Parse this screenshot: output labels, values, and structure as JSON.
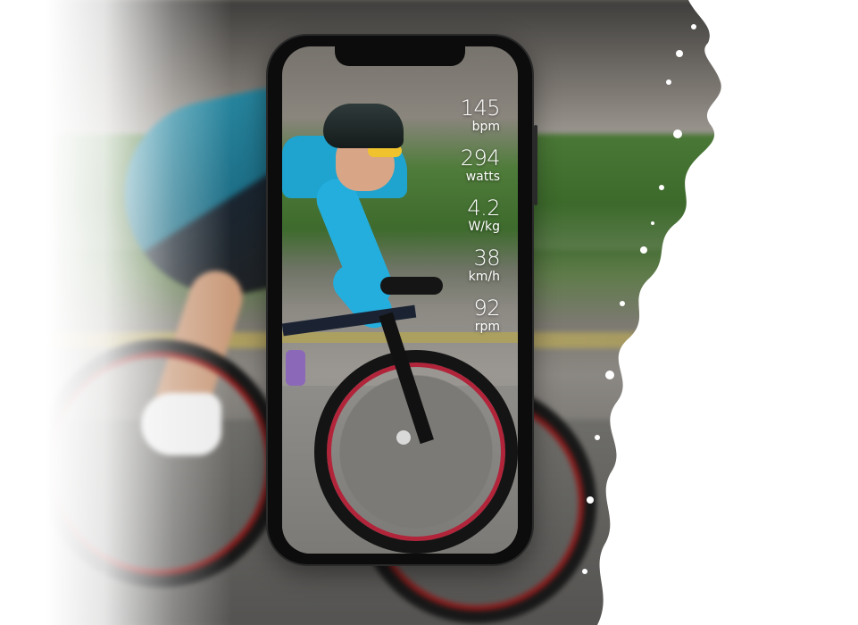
{
  "metrics": [
    {
      "value": "145",
      "unit": "bpm"
    },
    {
      "value": "294",
      "unit": "watts"
    },
    {
      "value": "4.2",
      "unit": "W/kg"
    },
    {
      "value": "38",
      "unit": "km/h"
    },
    {
      "value": "92",
      "unit": "rpm"
    }
  ],
  "colors": {
    "jersey": "#24aede",
    "glasses": "#f0c32e",
    "rim_accent": "#b1243a",
    "phone_frame": "#0c0c0c"
  }
}
